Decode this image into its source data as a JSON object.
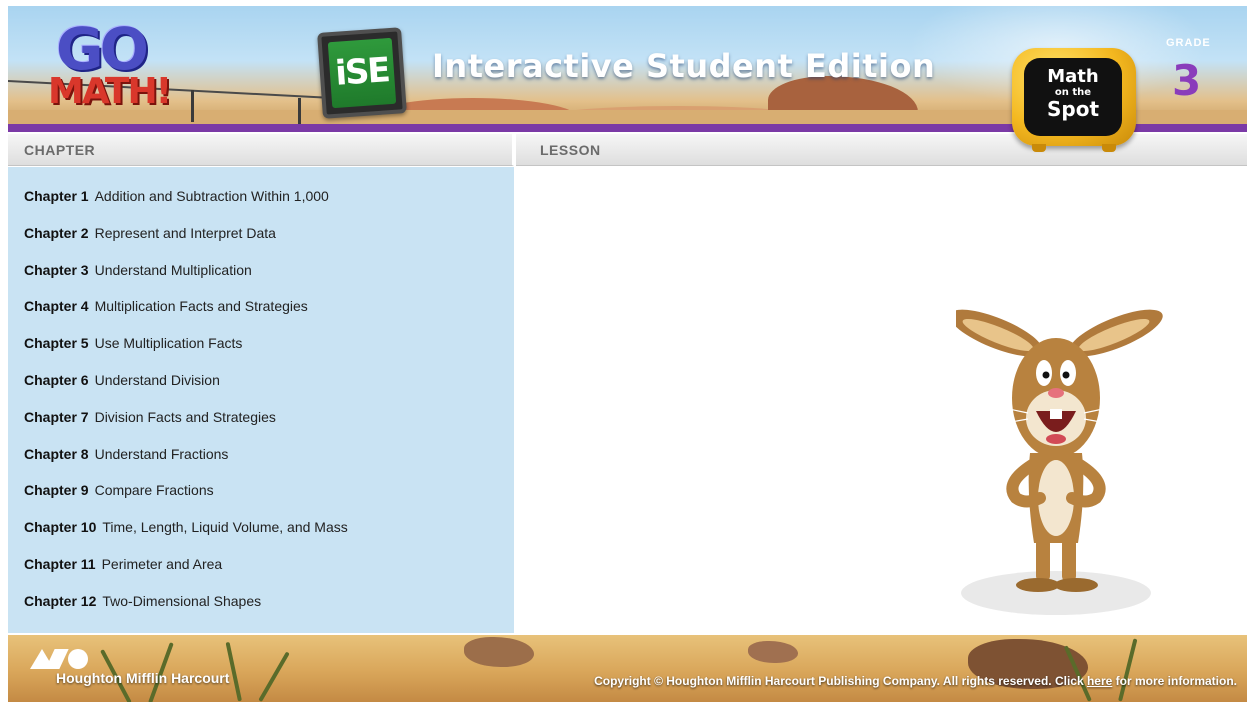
{
  "header": {
    "brand_logo_line1": "GO",
    "brand_logo_line2": "MATH!",
    "ise_badge": "iSE",
    "title": "Interactive Student Edition",
    "grade_label": "GRADE",
    "grade_value": "3",
    "tv_badge": {
      "line1": "Math",
      "line2": "on the",
      "line3": "Spot"
    }
  },
  "columns": {
    "chapter_heading": "CHAPTER",
    "lesson_heading": "LESSON"
  },
  "chapters": [
    {
      "num": "Chapter 1",
      "title": "Addition and Subtraction Within 1,000"
    },
    {
      "num": "Chapter 2",
      "title": "Represent and Interpret Data"
    },
    {
      "num": "Chapter 3",
      "title": "Understand Multiplication"
    },
    {
      "num": "Chapter 4",
      "title": "Multiplication Facts and Strategies"
    },
    {
      "num": "Chapter 5",
      "title": "Use Multiplication Facts"
    },
    {
      "num": "Chapter 6",
      "title": "Understand Division"
    },
    {
      "num": "Chapter 7",
      "title": "Division Facts and Strategies"
    },
    {
      "num": "Chapter 8",
      "title": "Understand Fractions"
    },
    {
      "num": "Chapter 9",
      "title": "Compare Fractions"
    },
    {
      "num": "Chapter 10",
      "title": "Time, Length, Liquid Volume, and Mass"
    },
    {
      "num": "Chapter 11",
      "title": "Perimeter and Area"
    },
    {
      "num": "Chapter 12",
      "title": "Two-Dimensional Shapes"
    }
  ],
  "footer": {
    "publisher": "Houghton Mifflin Harcourt",
    "copyright_prefix": "Copyright © Houghton Mifflin Harcourt Publishing Company. All rights reserved. Click ",
    "copyright_link": "here",
    "copyright_suffix": " for more information."
  },
  "colors": {
    "purple_bar": "#7b3aa6",
    "chapter_panel": "#c9e3f3",
    "grade_number": "#8a3cbb"
  },
  "icons": {
    "publisher_logo": "hmh-logo-icon",
    "mascot": "rabbit-mascot"
  }
}
